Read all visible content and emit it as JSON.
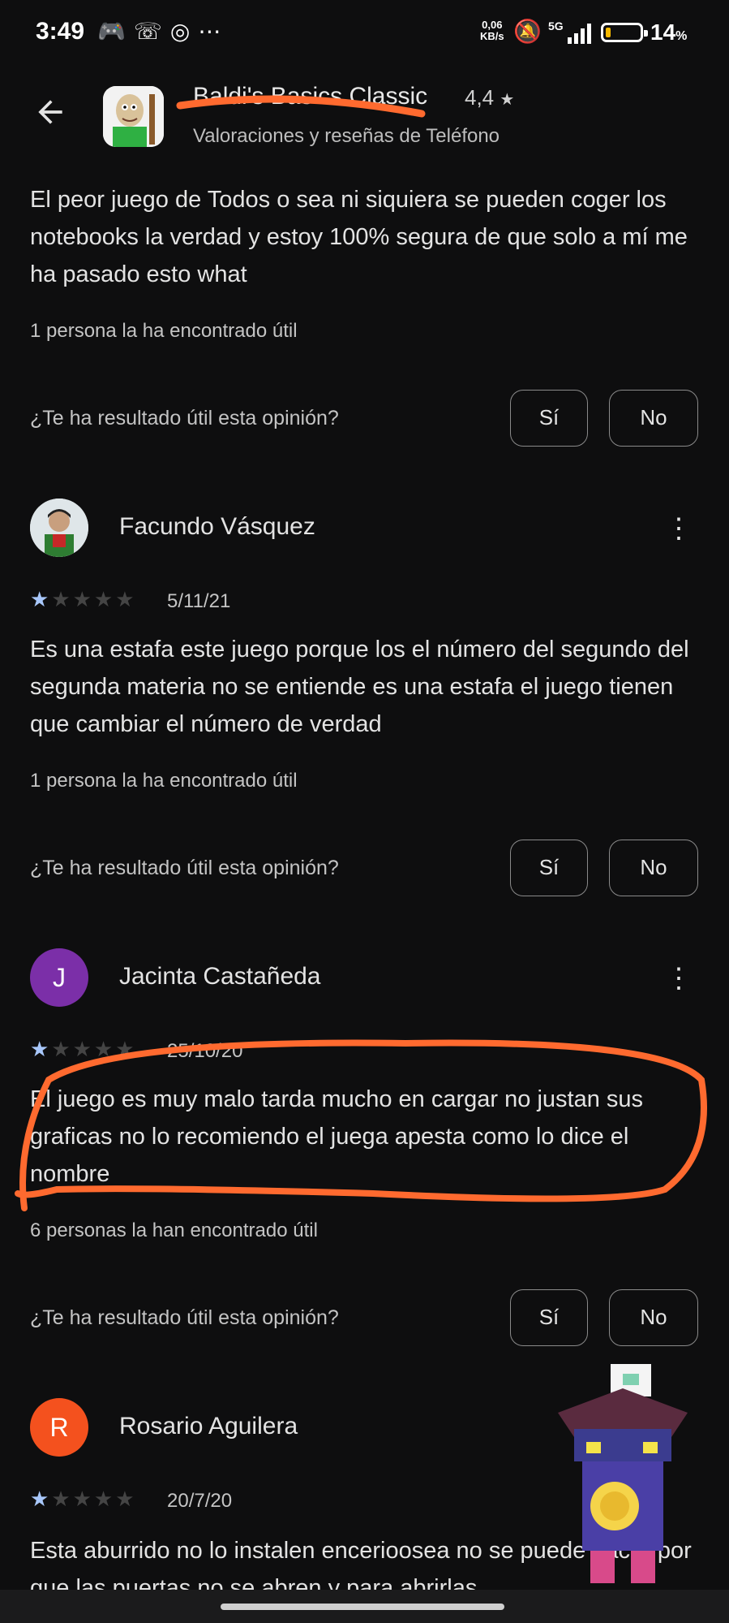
{
  "status_bar": {
    "time": "3:49",
    "net_speed_top": "0,06",
    "net_speed_bottom": "KB/s",
    "signal_label": "5G",
    "battery": "14",
    "battery_unit": "%",
    "battery_level": 0.14,
    "icons": [
      "discord-icon",
      "missed-call-icon",
      "nfc-icon",
      "more-icon",
      "bell-off-icon",
      "signal-icon",
      "battery-icon"
    ]
  },
  "header": {
    "back_icon": "arrow-back-icon",
    "app_title": "Baldi's Basics Classic",
    "rating": "4,4",
    "subtitle": "Valoraciones y reseñas de Teléfono"
  },
  "reviews": [
    {
      "body": "El peor juego de Todos o sea ni siquiera se pueden coger los notebooks la verdad y estoy 100% segura de que solo a mí me ha pasado esto what",
      "helpful": "1 persona la ha encontrado útil",
      "question": "¿Te ha resultado útil esta opinión?",
      "yes": "Sí",
      "no": "No"
    },
    {
      "name": "Facundo Vásquez",
      "stars": 1,
      "date": "5/11/21",
      "body": "Es una estafa este juego porque los el número del segundo del segunda materia no se entiende es una estafa el juego tienen que cambiar el número de verdad",
      "helpful": "1 persona la ha encontrado útil",
      "question": "¿Te ha resultado útil esta opinión?",
      "yes": "Sí",
      "no": "No"
    },
    {
      "name": "Jacinta Castañeda",
      "initial": "J",
      "avatar_color": "#7b2fa8",
      "stars": 1,
      "date": "25/10/20",
      "body": "El juego es muy malo tarda mucho en cargar no justan sus graficas no lo recomiendo el juega apesta como lo dice el nombre",
      "helpful": "6 personas la han encontrado útil",
      "question": "¿Te ha resultado útil esta opinión?",
      "yes": "Sí",
      "no": "No"
    },
    {
      "name": "Rosario Aguilera",
      "initial": "R",
      "avatar_color": "#f4511e",
      "stars": 1,
      "date": "20/7/20",
      "body": "Esta aburrido no lo instalen encerioosea no se puede hacer por que las puertas no se abren y para abrirlas"
    }
  ],
  "colors": {
    "background": "#0e0e0f",
    "star_on": "#a8c7fa",
    "annotation": "#ff6a2f"
  }
}
